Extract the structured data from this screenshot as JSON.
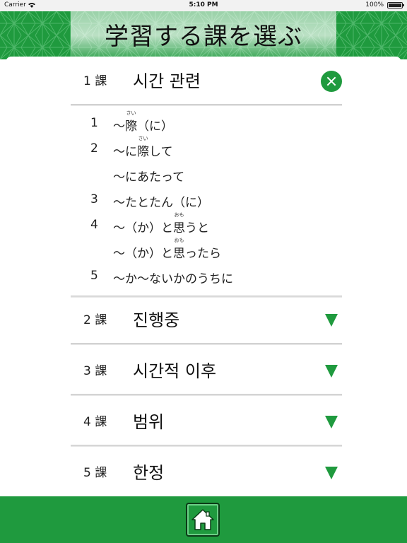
{
  "status_bar": {
    "carrier": "Carrier",
    "time": "5:10 PM",
    "battery_percent": "100%",
    "battery_level": 1.0
  },
  "header": {
    "title": "学習する課を選ぶ"
  },
  "lessons": [
    {
      "num": "1 課",
      "name": "시간 관련",
      "state": "expanded"
    },
    {
      "num": "2 課",
      "name": "진행중",
      "state": "collapsed"
    },
    {
      "num": "3 課",
      "name": "시간적 이후",
      "state": "collapsed"
    },
    {
      "num": "4 課",
      "name": "범위",
      "state": "collapsed"
    },
    {
      "num": "5 課",
      "name": "한정",
      "state": "collapsed"
    }
  ],
  "lesson1_items": [
    {
      "num": "1",
      "prefix": "〜",
      "kanji": "際",
      "ruby": "さい",
      "suffix": "（に）"
    },
    {
      "num": "2",
      "prefix": "〜に",
      "kanji": "際",
      "ruby": "さい",
      "suffix": "して"
    },
    {
      "num": "",
      "prefix": "〜にあたって",
      "kanji": "",
      "ruby": "",
      "suffix": ""
    },
    {
      "num": "3",
      "prefix": "〜たとたん（に）",
      "kanji": "",
      "ruby": "",
      "suffix": ""
    },
    {
      "num": "4",
      "prefix": "〜（か）と",
      "kanji": "思",
      "ruby": "おも",
      "suffix": "うと"
    },
    {
      "num": "",
      "prefix": "〜（か）と",
      "kanji": "思",
      "ruby": "おも",
      "suffix": "ったら"
    },
    {
      "num": "5",
      "prefix": "〜か〜ないかのうちに",
      "kanji": "",
      "ruby": "",
      "suffix": ""
    }
  ],
  "colors": {
    "brand_green": "#1f9a3e",
    "dark_green": "#0b3b17"
  },
  "icons": {
    "close": "close-icon",
    "expand": "triangle-down-icon",
    "home": "home-icon"
  }
}
